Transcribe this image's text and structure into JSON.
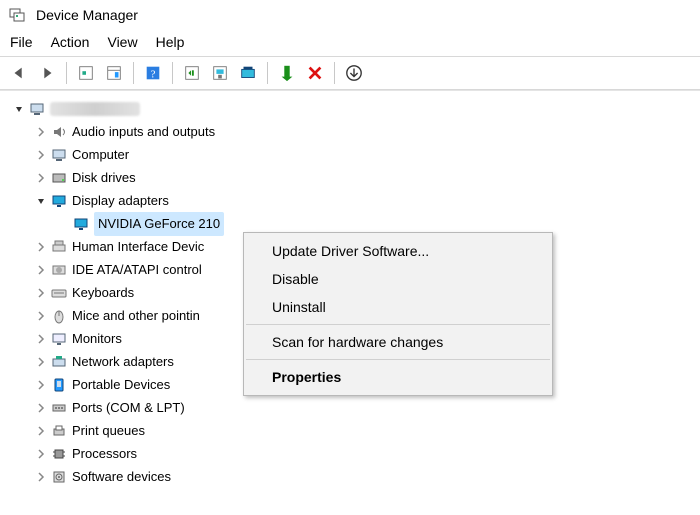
{
  "window": {
    "title": "Device Manager"
  },
  "menu": {
    "file": "File",
    "action": "Action",
    "view": "View",
    "help": "Help"
  },
  "toolbar_icons": [
    "back-arrow-icon",
    "forward-arrow-icon",
    "sep",
    "show-hidden-icon",
    "properties-panel-icon",
    "sep",
    "help-icon",
    "sep",
    "scan-hardware-icon",
    "update-driver-icon",
    "uninstall-device-icon",
    "sep",
    "enable-device-icon",
    "disable-device-icon",
    "sep",
    "down-arrow-circle-icon"
  ],
  "tree": [
    {
      "depth": 0,
      "arrow": "down",
      "icon": "computer-icon",
      "label": "",
      "root_blur": true
    },
    {
      "depth": 1,
      "arrow": "right",
      "icon": "audio-icon",
      "label": "Audio inputs and outputs"
    },
    {
      "depth": 1,
      "arrow": "right",
      "icon": "computer-icon",
      "label": "Computer"
    },
    {
      "depth": 1,
      "arrow": "right",
      "icon": "disk-icon",
      "label": "Disk drives"
    },
    {
      "depth": 1,
      "arrow": "down",
      "icon": "display-icon",
      "label": "Display adapters"
    },
    {
      "depth": 2,
      "arrow": "none",
      "icon": "display-icon",
      "label": "NVIDIA GeForce 210",
      "selected": true
    },
    {
      "depth": 1,
      "arrow": "right",
      "icon": "hid-icon",
      "label": "Human Interface Devic"
    },
    {
      "depth": 1,
      "arrow": "right",
      "icon": "ide-icon",
      "label": "IDE ATA/ATAPI control"
    },
    {
      "depth": 1,
      "arrow": "right",
      "icon": "keyboard-icon",
      "label": "Keyboards"
    },
    {
      "depth": 1,
      "arrow": "right",
      "icon": "mouse-icon",
      "label": "Mice and other pointin"
    },
    {
      "depth": 1,
      "arrow": "right",
      "icon": "monitor-icon",
      "label": "Monitors"
    },
    {
      "depth": 1,
      "arrow": "right",
      "icon": "network-icon",
      "label": "Network adapters"
    },
    {
      "depth": 1,
      "arrow": "right",
      "icon": "portable-icon",
      "label": "Portable Devices"
    },
    {
      "depth": 1,
      "arrow": "right",
      "icon": "ports-icon",
      "label": "Ports (COM & LPT)"
    },
    {
      "depth": 1,
      "arrow": "right",
      "icon": "printq-icon",
      "label": "Print queues"
    },
    {
      "depth": 1,
      "arrow": "right",
      "icon": "cpu-icon",
      "label": "Processors"
    },
    {
      "depth": 1,
      "arrow": "right",
      "icon": "software-icon",
      "label": "Software devices"
    }
  ],
  "context_menu": {
    "items": [
      {
        "label": "Update Driver Software..."
      },
      {
        "label": "Disable"
      },
      {
        "label": "Uninstall"
      },
      {
        "sep": true
      },
      {
        "label": "Scan for hardware changes"
      },
      {
        "sep": true
      },
      {
        "label": "Properties",
        "bold": true
      }
    ]
  }
}
